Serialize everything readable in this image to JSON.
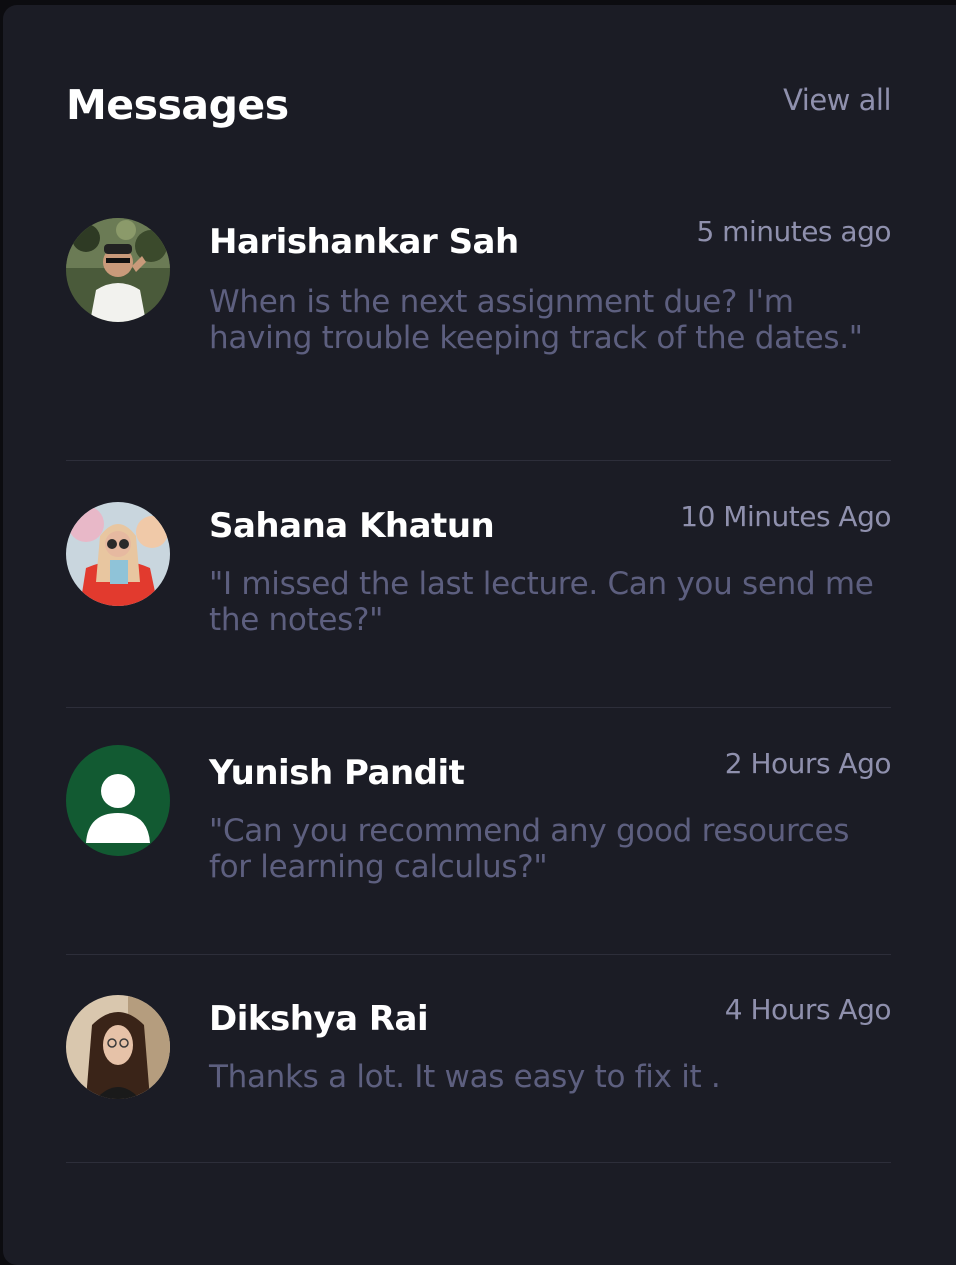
{
  "header": {
    "title": "Messages",
    "view_all": "View all"
  },
  "messages": [
    {
      "name": "Harishankar Sah",
      "time": "5 minutes ago",
      "text": "When is the next assignment due? I'm having trouble keeping track of the dates.\""
    },
    {
      "name": "Sahana Khatun",
      "time": "10 Minutes Ago",
      "text": "\"I missed the last lecture. Can you send me the notes?\""
    },
    {
      "name": "Yunish Pandit",
      "time": "2 Hours Ago",
      "text": "\"Can you recommend any good resources for learning calculus?\""
    },
    {
      "name": "Dikshya Rai",
      "time": "4 Hours Ago",
      "text": "Thanks a lot. It was easy to fix it ."
    }
  ],
  "colors": {
    "background": "#1b1c25",
    "title": "#ffffff",
    "muted": "#8f90ad",
    "message_text": "#5d5f7f",
    "default_avatar": "#125a32"
  }
}
